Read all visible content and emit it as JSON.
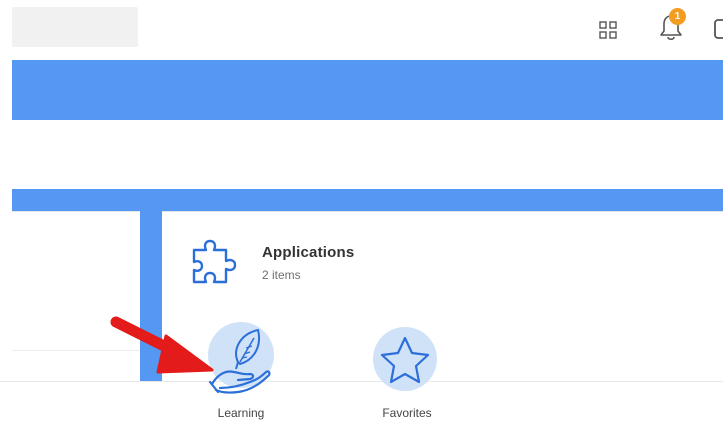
{
  "header": {
    "search_box": "",
    "notification_count": "1",
    "icons": [
      "apps-grid-icon",
      "bell-icon"
    ]
  },
  "applications_card": {
    "title": "Applications",
    "count": "2 items",
    "icon": "puzzle-icon"
  },
  "tiles": [
    {
      "label": "Learning",
      "icon": "hand-leaf-icon"
    },
    {
      "label": "Favorites",
      "icon": "star-icon"
    }
  ],
  "colors": {
    "brand_blue": "#5598f3",
    "tile_circle": "#cfe2f8",
    "badge": "#f29d22",
    "arrow": "#e31b1b"
  }
}
